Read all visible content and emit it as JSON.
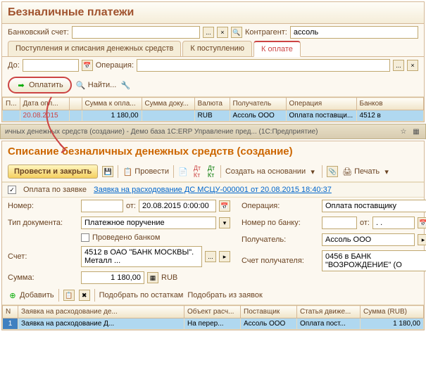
{
  "top": {
    "title": "Безналичные платежи",
    "bank_label": "Банковский счет:",
    "bank_value": "",
    "counterparty_label": "Контрагент:",
    "counterparty_value": "ассоль",
    "tabs": [
      "Поступления и списания денежных средств",
      "К поступлению",
      "К оплате"
    ],
    "do_label": "До:",
    "do_value": "",
    "operation_label": "Операция:",
    "operation_value": "",
    "pay_btn": "Оплатить",
    "find_btn": "Найти...",
    "columns": [
      "П...",
      "Дата опл...",
      "",
      "Сумма к опла...",
      "Сумма доку...",
      "Валюта",
      "Получатель",
      "Операция",
      "Банков"
    ],
    "row": {
      "date": "20.08.2015",
      "sum_pay": "1 180,00",
      "sum_doc": "",
      "currency": "RUB",
      "recipient": "Ассоль ООО",
      "operation": "Оплата поставщи...",
      "bank": "4512 в"
    }
  },
  "win_title": "ичных денежных средств (создание) - Демо база 1С:ERP Управление пред... (1С:Предприятие)",
  "bottom": {
    "title": "Списание безналичных денежных средств (создание)",
    "save_close": "Провести и закрыть",
    "post": "Провести",
    "create_based": "Создать на основании",
    "print": "Печать",
    "pay_by_request": "Оплата по заявке",
    "request_link": "Заявка на расходование ДС МСЦУ-000001 от 20.08.2015 18:40:37",
    "number_label": "Номер:",
    "number_value": "",
    "from_label": "от:",
    "date_value": "20.08.2015 0:00:00",
    "operation_label": "Операция:",
    "operation_value": "Оплата поставщику",
    "doctype_label": "Тип документа:",
    "doctype_value": "Платежное поручение",
    "banknum_label": "Номер по банку:",
    "banknum_value": "",
    "bankfrom_label": "от:",
    "bankfrom_value": ". .",
    "bank_processed": "Проведено банком",
    "recipient_label": "Получатель:",
    "recipient_value": "Ассоль ООО",
    "account_label": "Счет:",
    "account_value": "4512 в ОАО \"БАНК МОСКВЫ\". Металл ...",
    "recip_account_label": "Счет получателя:",
    "recip_account_value": "0456 в БАНК \"ВОЗРОЖДЕНИЕ\" (О",
    "sum_label": "Сумма:",
    "sum_value": "1 180,00",
    "sum_currency": "RUB",
    "add_btn": "Добавить",
    "pick_remains": "Подобрать по остаткам",
    "pick_requests": "Подобрать из заявок",
    "columns": [
      "N",
      "Заявка на расходование де...",
      "Объект расч...",
      "Поставщик",
      "Статья движе...",
      "Сумма (RUB)"
    ],
    "row": {
      "n": "1",
      "request": "Заявка на расходование Д...",
      "object": "На перер...",
      "supplier": "Ассоль ООО",
      "article": "Оплата пост...",
      "sum": "1 180,00"
    }
  }
}
